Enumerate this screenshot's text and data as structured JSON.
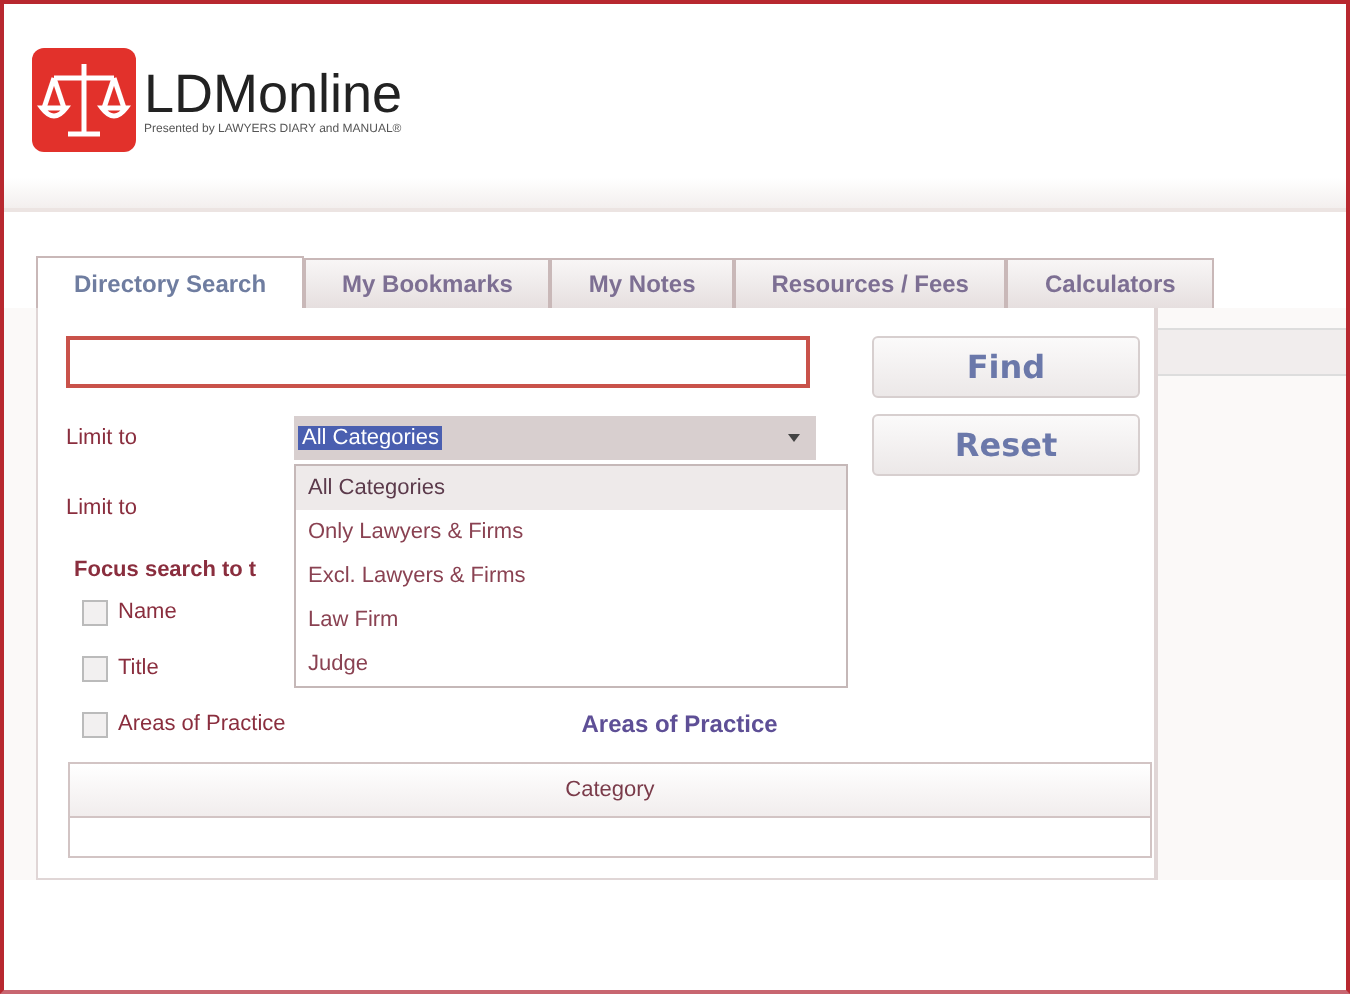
{
  "logo": {
    "name": "LDMonline",
    "tagline": "Presented by LAWYERS DIARY and MANUAL®"
  },
  "tabs": [
    {
      "label": "Directory Search",
      "selected": true
    },
    {
      "label": "My Bookmarks",
      "selected": false
    },
    {
      "label": "My Notes",
      "selected": false
    },
    {
      "label": "Resources / Fees",
      "selected": false
    },
    {
      "label": "Calculators",
      "selected": false
    }
  ],
  "buttons": {
    "find": "Find",
    "reset": "Reset"
  },
  "limit_rows": [
    {
      "label": "Limit to",
      "value": "All Categories"
    },
    {
      "label": "Limit to"
    }
  ],
  "dropdown": {
    "options": [
      {
        "label": "All Categories",
        "selected": true
      },
      {
        "label": "Only Lawyers & Firms",
        "selected": false
      },
      {
        "label": "Excl. Lawyers & Firms",
        "selected": false
      },
      {
        "label": "Law Firm",
        "selected": false
      },
      {
        "label": "Judge",
        "selected": false
      }
    ]
  },
  "focus_label": "Focus search to t",
  "focus_options": [
    {
      "label": "Name",
      "checked": false
    },
    {
      "label": "Title",
      "checked": false
    },
    {
      "label": "Areas of Practice",
      "checked": false
    }
  ],
  "areas_link": "Areas of Practice",
  "table": {
    "columns": [
      "Category"
    ]
  }
}
